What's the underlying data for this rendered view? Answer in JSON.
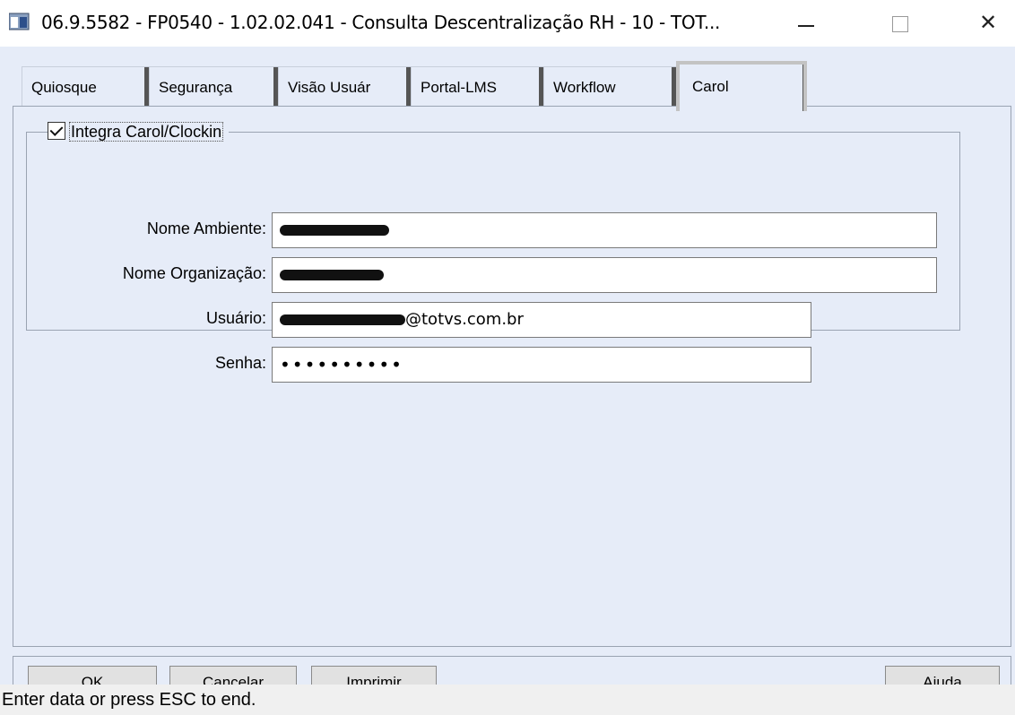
{
  "window": {
    "title": "06.9.5582 - FP0540 - 1.02.02.041 - Consulta Descentralização RH - 10 - TOT...",
    "minimize_icon": "minimize-icon",
    "maximize_icon": "maximize-icon",
    "close_glyph": "✕"
  },
  "tabs": [
    {
      "label": "Quiosque"
    },
    {
      "label": "Segurança"
    },
    {
      "label": "Visão Usuár"
    },
    {
      "label": "Portal-LMS"
    },
    {
      "label": "Workflow"
    },
    {
      "label": "Carol",
      "active": true
    }
  ],
  "group": {
    "checkbox_label": "Integra Carol/Clockin",
    "checked": true
  },
  "fields": {
    "ambiente": {
      "label": "Nome Ambiente:",
      "value": ""
    },
    "organizacao": {
      "label": "Nome Organização:",
      "value": ""
    },
    "usuario": {
      "label": "Usuário:",
      "value_suffix": "@totvs.com.br"
    },
    "senha": {
      "label": "Senha:",
      "value": "••••••••••"
    }
  },
  "buttons": {
    "ok": "OK",
    "cancel": "Cancelar",
    "print": "Imprimir",
    "help": "Ajuda"
  },
  "status": "Enter data or press ESC to end."
}
